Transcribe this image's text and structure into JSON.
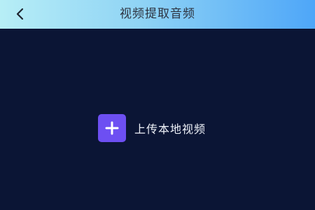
{
  "header": {
    "title": "视频提取音频",
    "back_icon": "chevron-left-icon"
  },
  "main": {
    "upload_label": "上传本地视频",
    "upload_icon": "plus-icon"
  },
  "colors": {
    "header_gradient_start": "#b7eef6",
    "header_gradient_end": "#4ea6f8",
    "background": "#0b1535",
    "accent": "#6d4ff2",
    "text_light": "#eef1f8",
    "text_dark": "#2d3340"
  }
}
